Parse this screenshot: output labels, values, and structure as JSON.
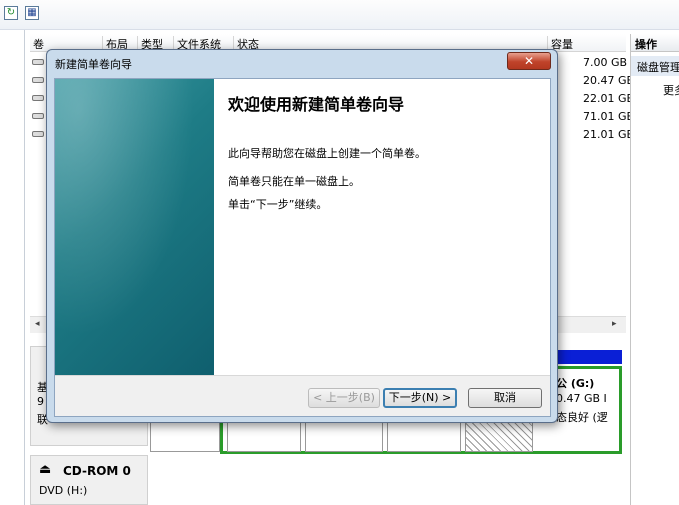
{
  "toolbar": {
    "refresh_icon": "refresh-icon",
    "console_icon": "console-icon"
  },
  "volume_list": {
    "columns": [
      "卷",
      "布局",
      "类型",
      "文件系统",
      "状态",
      "容量"
    ],
    "capacities": [
      "7.00 GB",
      "20.47 GB",
      "22.01 GB",
      "71.01 GB",
      "21.01 GB"
    ]
  },
  "disk_view": {
    "partition_label": "公 (G:)",
    "partition_size": "0.47 GB I",
    "partition_status": "态良好 (逻",
    "cdrom_name": "CD-ROM 0",
    "cdrom_drive": "DVD (H:)",
    "partial_labels": [
      "基",
      "9",
      "联"
    ]
  },
  "actions_pane": {
    "title": "操作",
    "selected_item": "磁盘管理",
    "more": "更多"
  },
  "wizard": {
    "title": "新建简单卷向导",
    "heading": "欢迎使用新建简单卷向导",
    "line1": "此向导帮助您在磁盘上创建一个简单卷。",
    "line2": "简单卷只能在单一磁盘上。",
    "line3": "单击“下一步”继续。",
    "back": "< 上一步(B)",
    "next": "下一步(N) >",
    "cancel": "取消",
    "close": "✕"
  },
  "colors": {
    "accent": "#2a9c2a",
    "partition_bar": "#0a1fd6",
    "wizard_art": "#1e7c86"
  }
}
